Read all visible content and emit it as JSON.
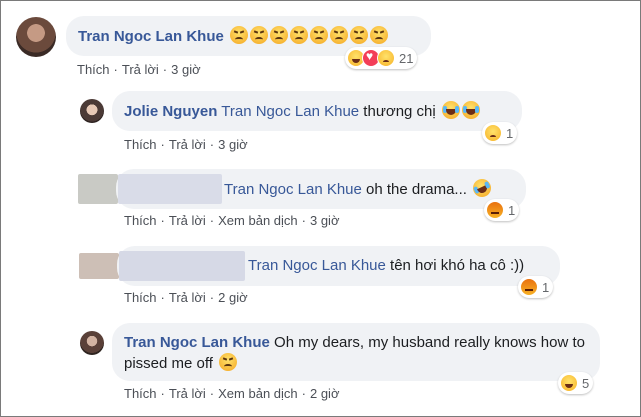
{
  "comments": [
    {
      "author": "Tran Ngoc Lan Khue",
      "emoji": "angry",
      "emoji_count": 8,
      "actions": [
        "Thích",
        "Trả lời",
        "3 giờ"
      ],
      "reactions": [
        "haha",
        "love",
        "sad"
      ],
      "reaction_count": "21"
    },
    {
      "author": "Jolie Nguyen",
      "mention": "Tran Ngoc Lan Khue",
      "text": " thương chị",
      "emoji": "laugh",
      "emoji_count": 2,
      "actions": [
        "Thích",
        "Trả lời",
        "3 giờ"
      ],
      "reactions": [
        "sad"
      ],
      "reaction_count": "1"
    },
    {
      "author_hidden": true,
      "mention": "Tran Ngoc Lan Khue",
      "text": " oh the drama...",
      "emoji": "rofl",
      "actions": [
        "Thích",
        "Trả lời",
        "Xem bản dịch",
        "3 giờ"
      ],
      "reactions": [
        "angry"
      ],
      "reaction_count": "1"
    },
    {
      "author_hidden": true,
      "mention": "Tran Ngoc Lan Khue",
      "text": " tên hơi khó ha cô :))",
      "actions": [
        "Thích",
        "Trả lời",
        "2 giờ"
      ],
      "reactions": [
        "angry"
      ],
      "reaction_count": "1"
    },
    {
      "author": "Tran Ngoc Lan Khue",
      "text": " Oh my dears, my husband really knows how to pissed me off",
      "emoji": "angry",
      "actions": [
        "Thích",
        "Trả lời",
        "Xem bản dịch",
        "2 giờ"
      ],
      "reactions": [
        "haha"
      ],
      "reaction_count": "5"
    }
  ],
  "colors": {
    "link": "#385898",
    "bubble": "#f0f2f5",
    "meta": "#4b4f56"
  }
}
